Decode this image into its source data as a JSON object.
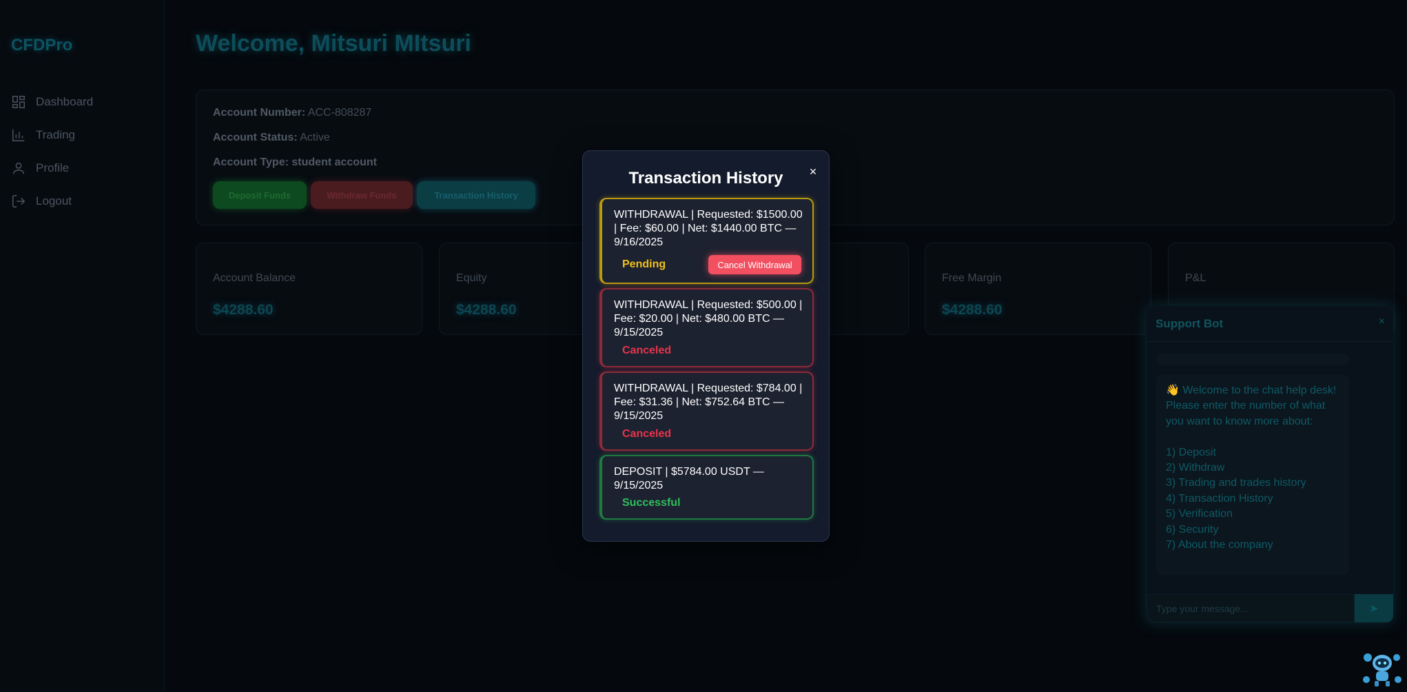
{
  "sidebar": {
    "brand": "CFDPro",
    "items": [
      {
        "label": "Dashboard",
        "icon": "dashboard-icon"
      },
      {
        "label": "Trading",
        "icon": "chart-icon"
      },
      {
        "label": "Profile",
        "icon": "user-icon"
      },
      {
        "label": "Logout",
        "icon": "logout-icon"
      }
    ]
  },
  "header": {
    "welcome": "Welcome, Mitsuri MItsuri"
  },
  "account": {
    "number_label": "Account Number:",
    "number": "ACC-808287",
    "status_label": "Account Status:",
    "status": "Active",
    "type_label": "Account Type:",
    "type": "student account",
    "deposit_button": "Deposit Funds",
    "withdraw_button": "Withdraw Funds",
    "history_button": "Transaction History"
  },
  "stats": [
    {
      "label": "Account Balance",
      "value": "$4288.60"
    },
    {
      "label": "Equity",
      "value": "$4288.60"
    },
    {
      "label": "Free Margin",
      "value": "$4288.60"
    },
    {
      "label": "P&L",
      "value": ""
    }
  ],
  "modal": {
    "title": "Transaction History",
    "close": "×",
    "transactions": [
      {
        "text": "WITHDRAWAL | Requested: $1500.00 | Fee: $60.00 | Net: $1440.00 BTC — 9/16/2025",
        "status": "Pending",
        "action": "Cancel Withdrawal",
        "color": "#f0c01a"
      },
      {
        "text": "WITHDRAWAL | Requested: $500.00 | Fee: $20.00 | Net: $480.00 BTC — 9/15/2025",
        "status": "Canceled",
        "color": "#e8344b"
      },
      {
        "text": "WITHDRAWAL | Requested: $784.00 | Fee: $31.36 | Net: $752.64 BTC — 9/15/2025",
        "status": "Canceled",
        "color": "#e8344b"
      },
      {
        "text": "DEPOSIT | $5784.00 USDT — 9/15/2025",
        "status": "Successful",
        "color": "#2fbf5c"
      }
    ]
  },
  "bot": {
    "title": "Support Bot",
    "close": "×",
    "message": "👋 Welcome to the chat help desk!\nPlease enter the number of what you want to know more about:\n\n1) Deposit\n2) Withdraw\n3) Trading and trades history\n4) Transaction History\n5) Verification\n6) Security\n7) About the company",
    "input_placeholder": "Type your message...",
    "send": "➤"
  }
}
